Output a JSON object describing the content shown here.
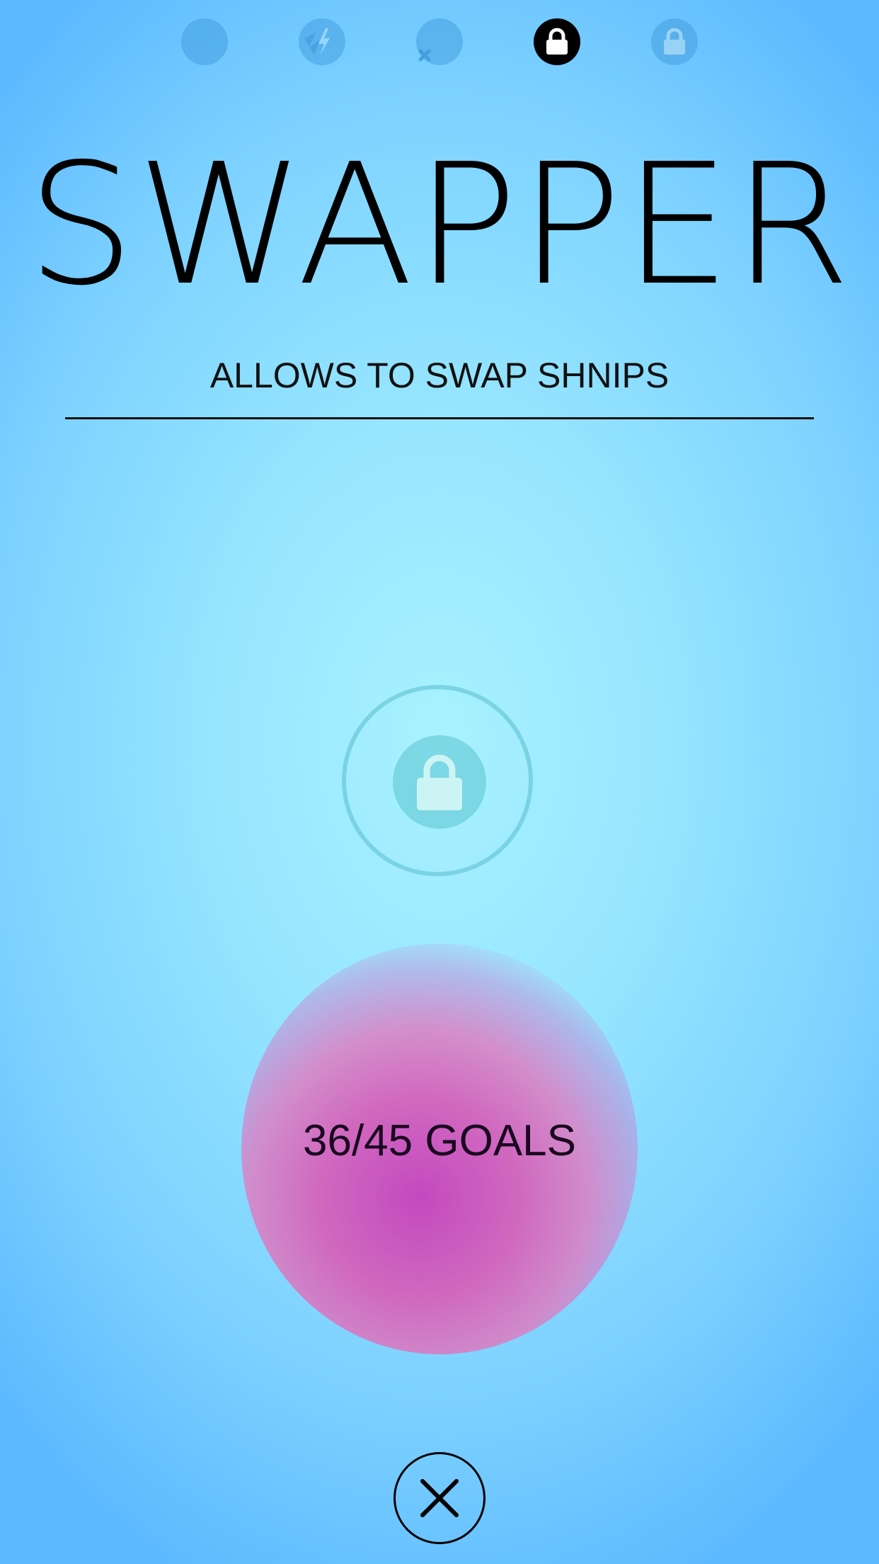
{
  "header": {
    "tabs": [
      {
        "icon": "blank-circle-icon",
        "state": "dim"
      },
      {
        "icon": "lightning-icon",
        "state": "dim"
      },
      {
        "icon": "cross-bomb-icon",
        "state": "dim"
      },
      {
        "icon": "lock-icon",
        "state": "active"
      },
      {
        "icon": "lock-icon",
        "state": "dim"
      }
    ]
  },
  "powerup": {
    "title": "SWAPPER",
    "description": "ALLOWS TO SWAP SHNIPS",
    "status_icon": "lock-icon",
    "progress_text": "36/45 GOALS",
    "progress_fraction": 0.8
  },
  "footer": {
    "close_icon": "close-icon"
  },
  "colors": {
    "background_center": "#a8f2ff",
    "background_edge": "#5cb8ff",
    "blob": "#c446be",
    "text": "#000000"
  }
}
